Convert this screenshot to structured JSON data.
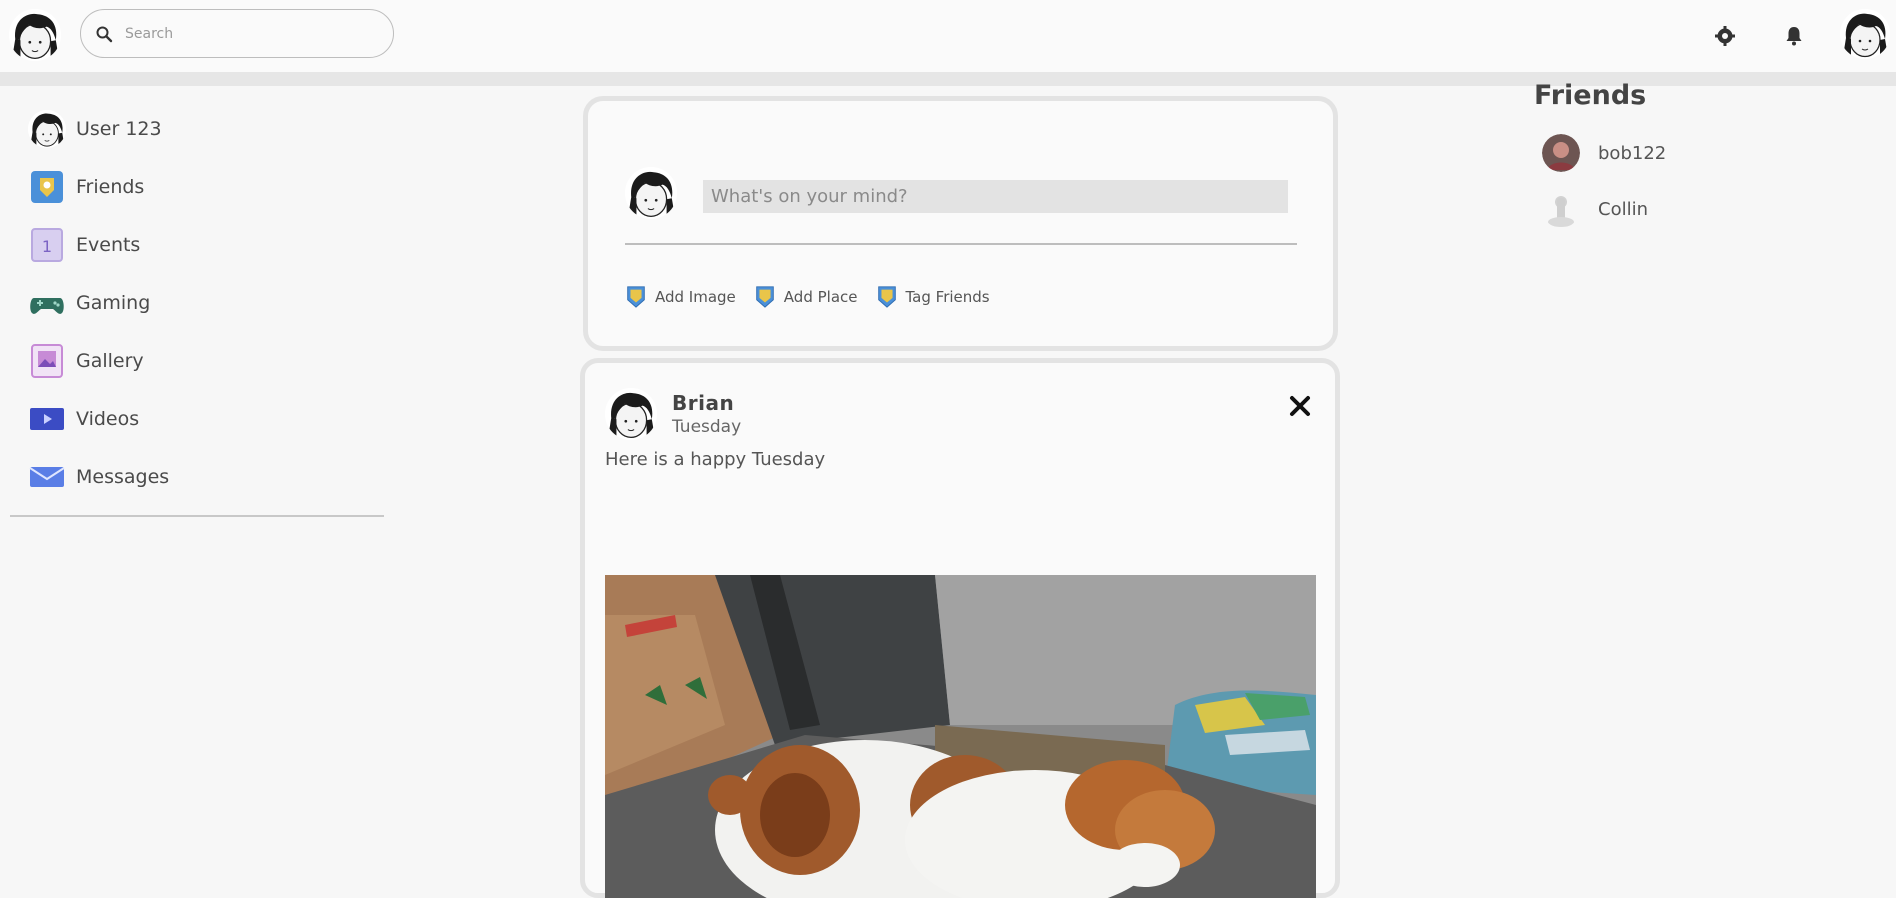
{
  "header": {
    "search": {
      "placeholder": "Search",
      "icon": "search-icon"
    },
    "icons": [
      "gear-icon",
      "bell-icon"
    ]
  },
  "sidebar": {
    "items": [
      {
        "label": "User 123",
        "icon": "user-avatar-icon"
      },
      {
        "label": "Friends",
        "icon": "friends-icon",
        "color": "#4a90d9"
      },
      {
        "label": "Events",
        "icon": "events-icon",
        "color": "#b9a9e0"
      },
      {
        "label": "Gaming",
        "icon": "gamepad-icon",
        "color": "#2f6f5f"
      },
      {
        "label": "Gallery",
        "icon": "gallery-icon",
        "color": "#c78bd6"
      },
      {
        "label": "Videos",
        "icon": "video-icon",
        "color": "#3b4cc4"
      },
      {
        "label": "Messages",
        "icon": "messages-icon",
        "color": "#5a7ee6"
      }
    ]
  },
  "composer": {
    "placeholder": "What's on your mind?",
    "actions": [
      {
        "label": "Add Image",
        "icon": "add-image-icon"
      },
      {
        "label": "Add Place",
        "icon": "add-place-icon"
      },
      {
        "label": "Tag Friends",
        "icon": "tag-friends-icon"
      }
    ]
  },
  "post": {
    "author": "Brian",
    "date": "Tuesday",
    "text": "Here is a happy Tuesday"
  },
  "friends_panel": {
    "title": "Friends",
    "friends": [
      {
        "name": "bob122"
      },
      {
        "name": "Collin"
      }
    ]
  },
  "colors": {
    "background": "#f7f7f7",
    "card_border": "#e3e3e3",
    "input_fill": "#e3e3e3",
    "badge_blue": "#4a90d9"
  }
}
